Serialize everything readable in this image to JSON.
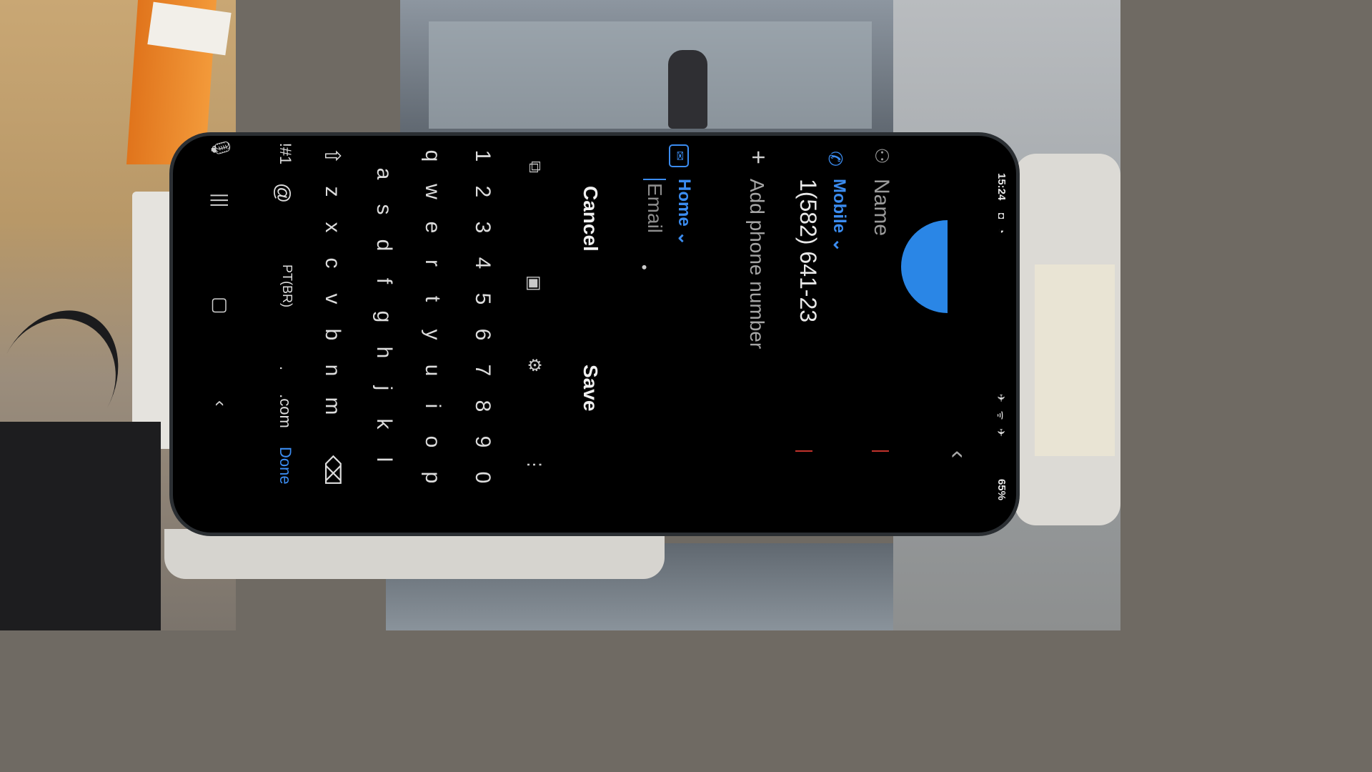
{
  "status_bar": {
    "time": "15:24",
    "left_icons": "◘ ◔",
    "right_icons": "✈ ᯤ ✈",
    "battery": "65%"
  },
  "header": {
    "back_icon": "chevron-left-icon"
  },
  "form": {
    "name_placeholder": "Name",
    "phone": {
      "type_label": "Mobile ⌄",
      "number": "1(582) 641-23"
    },
    "add_phone_label": "Add phone number",
    "email": {
      "type_label": "Home ⌄",
      "placeholder": "Email",
      "dot": "•"
    }
  },
  "actions": {
    "cancel": "Cancel",
    "save": "Save"
  },
  "keyboard": {
    "tools": [
      "⧉",
      "▣",
      "⚙",
      "⋮"
    ],
    "numbers": [
      "1",
      "2",
      "3",
      "4",
      "5",
      "6",
      "7",
      "8",
      "9",
      "0"
    ],
    "row_q": [
      "q",
      "w",
      "e",
      "r",
      "t",
      "y",
      "u",
      "i",
      "o",
      "p"
    ],
    "row_a": [
      "a",
      "s",
      "d",
      "f",
      "g",
      "h",
      "j",
      "k",
      "l"
    ],
    "row_z": [
      "⇧",
      "z",
      "x",
      "c",
      "v",
      "b",
      "n",
      "m",
      "⌫"
    ],
    "bottom": [
      "!#1",
      "@",
      "PT(BR)",
      ".",
      ".com",
      "Done"
    ]
  },
  "navbar": {
    "mic": "🎙",
    "recents": "|||",
    "home": "▢",
    "back": "‹"
  }
}
